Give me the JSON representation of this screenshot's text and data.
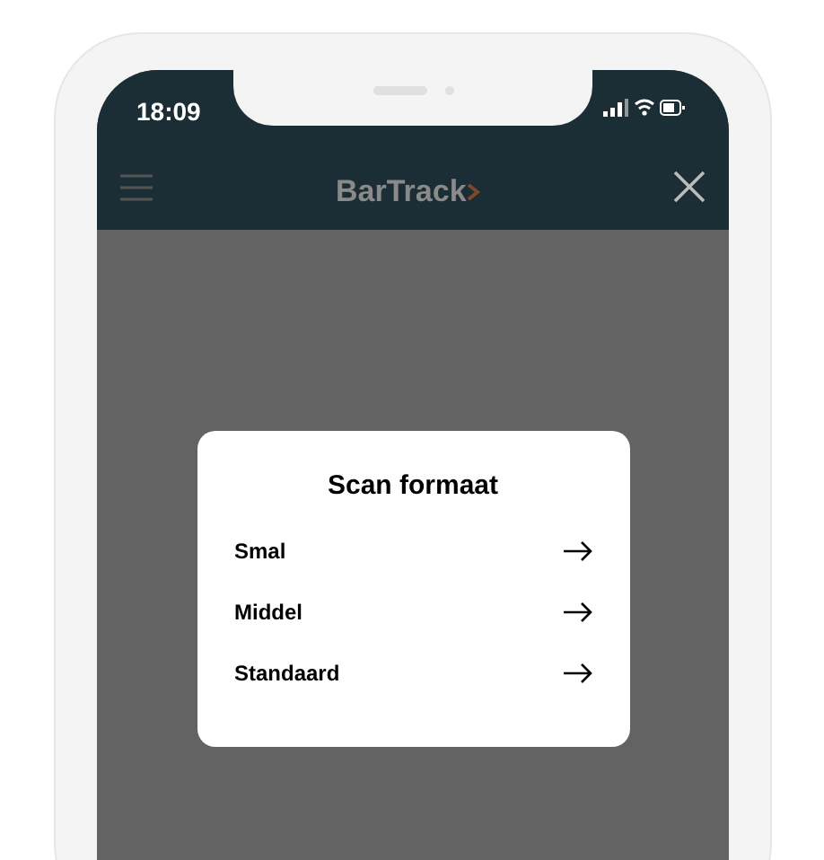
{
  "status_bar": {
    "time": "18:09"
  },
  "header": {
    "logo": "BarTrack"
  },
  "dialog": {
    "title": "Scan formaat",
    "options": [
      {
        "label": "Smal"
      },
      {
        "label": "Middel"
      },
      {
        "label": "Standaard"
      }
    ]
  }
}
